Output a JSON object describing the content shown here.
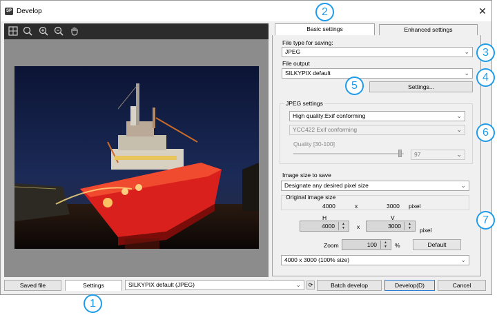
{
  "window": {
    "title": "Develop",
    "app_icon": "SP"
  },
  "toolbar": {
    "icons": [
      "grid-icon",
      "zoom-fit-icon",
      "zoom-in-icon",
      "zoom-out-icon",
      "hand-icon"
    ]
  },
  "tabs": {
    "basic": "Basic settings",
    "enhanced": "Enhanced settings"
  },
  "basic": {
    "file_type_label": "File type for saving:",
    "file_type_value": "JPEG",
    "file_output_label": "File output",
    "file_output_value": "SILKYPIX default",
    "settings_button": "Settings...",
    "jpeg_label": "JPEG settings",
    "jpeg_quality_mode": "High quality:Exif conforming",
    "jpeg_sampling": "YCC422 Exif conforming",
    "quality_label": "Quality [30-100]",
    "quality_value": "97",
    "quality_level": 0.97,
    "image_size_label": "Image size to save",
    "image_size_mode": "Designate any desired pixel size",
    "original_label": "Original image size",
    "orig_w": "4000",
    "orig_x": "x",
    "orig_h": "3000",
    "orig_unit": "pixel",
    "h_label": "H",
    "v_label": "V",
    "h_value": "4000",
    "v_value": "3000",
    "hv_x": "x",
    "hv_unit": "pixel",
    "zoom_label": "Zoom",
    "zoom_value": "100",
    "zoom_unit": "%",
    "default_button": "Default",
    "size_summary": "4000 x  3000  (100% size)"
  },
  "bottom": {
    "saved_file": "Saved file",
    "settings": "Settings",
    "preset": "SILKYPIX default (JPEG)",
    "batch_develop": "Batch develop",
    "develop": "Develop(D)",
    "cancel": "Cancel"
  },
  "callouts": [
    "1",
    "2",
    "3",
    "4",
    "5",
    "6",
    "7"
  ],
  "colors": {
    "callout": "#1e9be9",
    "preview_bg": "#8c8c8c",
    "toolbar_bg": "#2c2c2c",
    "boat_hull": "#d9201c"
  }
}
